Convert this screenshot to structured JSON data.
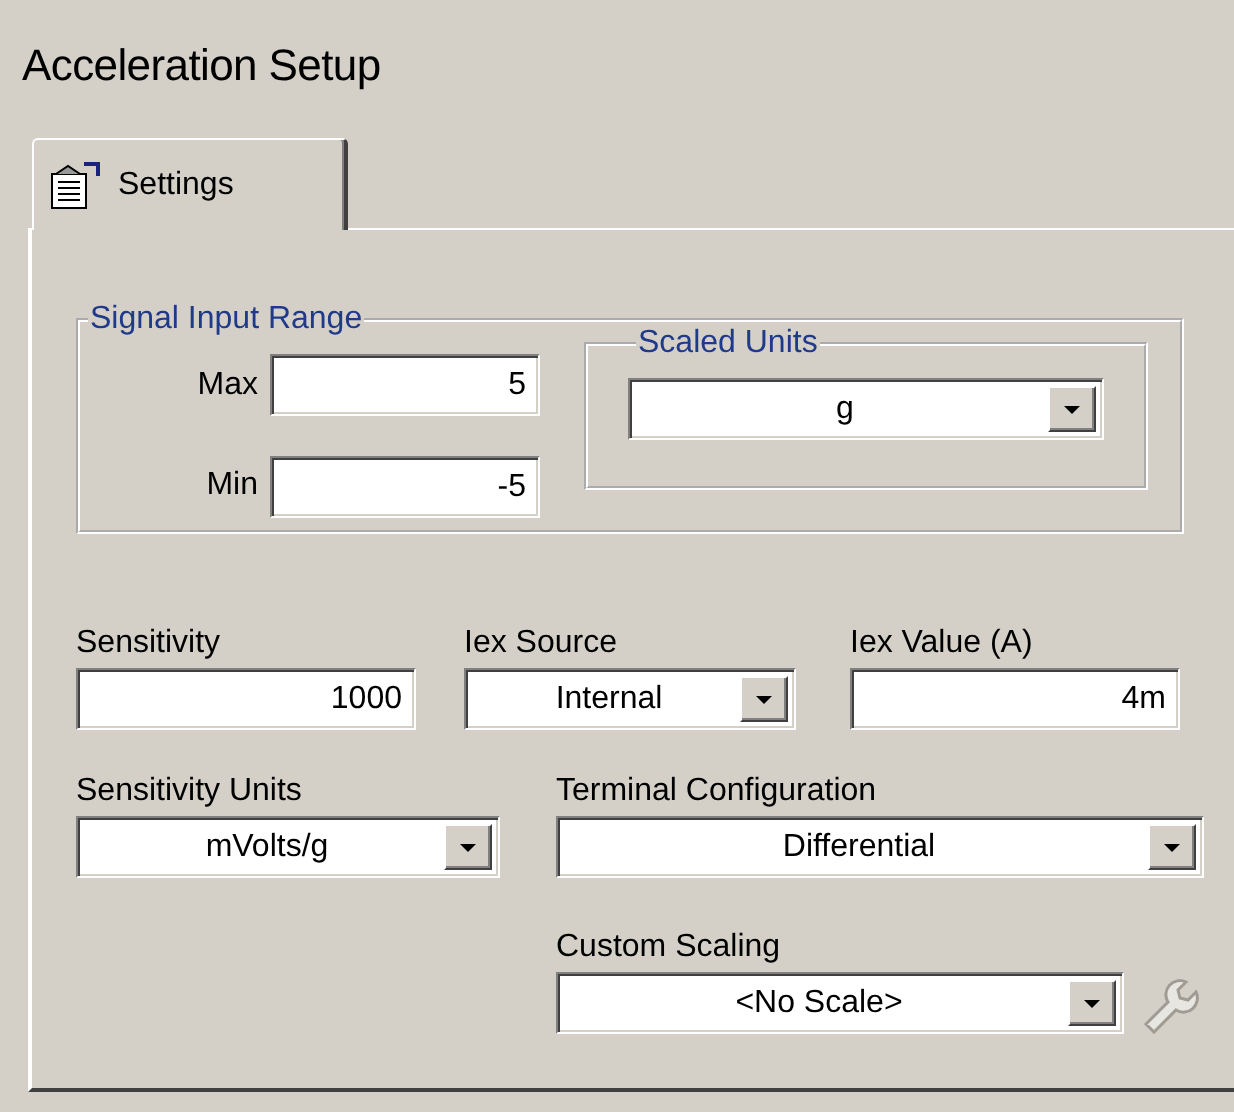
{
  "title": "Acceleration Setup",
  "tabs": [
    {
      "label": "Settings",
      "selected": true
    }
  ],
  "signal_input_range": {
    "title": "Signal Input Range",
    "fields": [
      {
        "label": "Max",
        "value": "5"
      },
      {
        "label": "Min",
        "value": "-5"
      }
    ]
  },
  "scaled_units": {
    "title": "Scaled Units",
    "value": "g"
  },
  "controls": [
    {
      "kind": "text",
      "label": "Sensitivity",
      "value": "1000"
    },
    {
      "kind": "combo",
      "label": "Iex Source",
      "value": "Internal"
    },
    {
      "kind": "text",
      "label": "Iex Value (A)",
      "value": "4m"
    },
    {
      "kind": "combo",
      "label": "Sensitivity Units",
      "value": "mVolts/g"
    },
    {
      "kind": "combo",
      "label": "Terminal Configuration",
      "value": "Differential"
    },
    {
      "kind": "combo",
      "label": "Custom Scaling",
      "value": "<No Scale>"
    }
  ]
}
